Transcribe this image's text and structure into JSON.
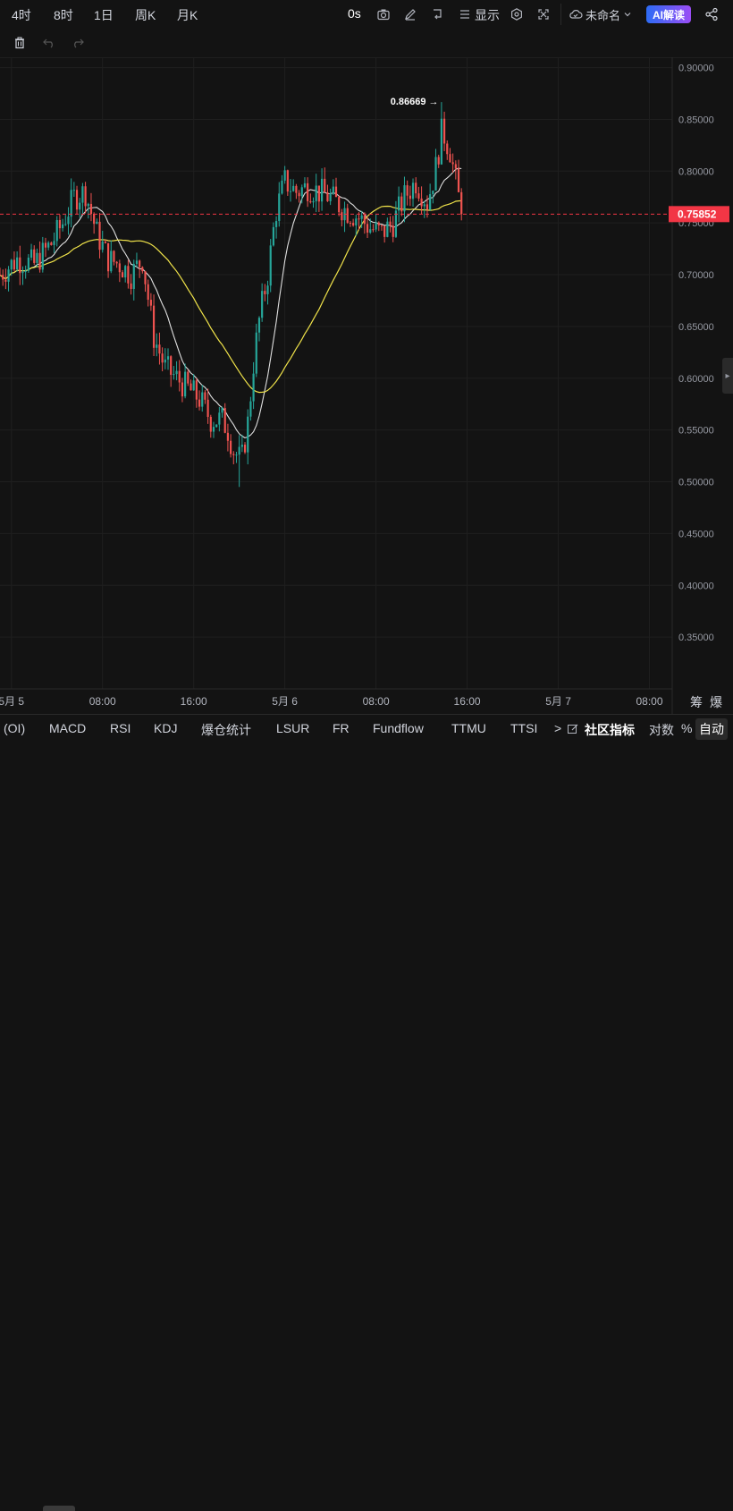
{
  "toolbar": {
    "timeframes": [
      "4时",
      "8时",
      "1日",
      "周K",
      "月K"
    ],
    "countdown": "0s",
    "display_label": "显示",
    "layout_name": "未命名",
    "ai_label": "AI解读"
  },
  "bottom_bar": {
    "indicators": [
      "(OI)",
      "MACD",
      "RSI",
      "KDJ",
      "爆仓统计",
      "LSUR",
      "FR",
      "Fundflow",
      "TTMU",
      "TTSI"
    ],
    "more_label": ">",
    "community_label": "社区指标",
    "log_label": "对数",
    "percent_label": "%",
    "auto_label": "自动"
  },
  "colors": {
    "up": "#26a69a",
    "down": "#ef5350",
    "ma_fast": "#e0e0e0",
    "ma_slow": "#f0e34a",
    "price_tag": "#f23645",
    "background": "#131313",
    "grid": "#1f1f1f"
  },
  "chart_data": {
    "type": "candlestick",
    "symbol_price": "0.75852",
    "high_marker": "0.86669 →",
    "y_ticks": [
      "0.90000",
      "0.85000",
      "0.80000",
      "0.75000",
      "0.70000",
      "0.65000",
      "0.60000",
      "0.55000",
      "0.50000",
      "0.45000",
      "0.40000",
      "0.35000"
    ],
    "x_ticks": [
      "5月 5",
      "08:00",
      "16:00",
      "5月 6",
      "08:00",
      "16:00",
      "5月 7",
      "08:00"
    ],
    "x_tick_hours": [
      0,
      8,
      16,
      24,
      32,
      40,
      48,
      56
    ],
    "axis_extra": [
      "筹",
      "爆"
    ],
    "ylim": [
      0.3,
      0.91
    ],
    "xlim": [
      -1,
      58
    ],
    "last_price": 0.75852,
    "high": {
      "hour": 37.8,
      "value": 0.86669
    },
    "low": {
      "hour": 19.9,
      "value": 0.495
    },
    "path_points": [
      [
        -1,
        0.7
      ],
      [
        0.5,
        0.715
      ],
      [
        2,
        0.71
      ],
      [
        3.5,
        0.73
      ],
      [
        4.5,
        0.75
      ],
      [
        5.5,
        0.775
      ],
      [
        6.5,
        0.78
      ],
      [
        7.5,
        0.74
      ],
      [
        8.5,
        0.715
      ],
      [
        9.5,
        0.71
      ],
      [
        10.5,
        0.7
      ],
      [
        11.5,
        0.715
      ],
      [
        12.5,
        0.64
      ],
      [
        13.5,
        0.61
      ],
      [
        14.5,
        0.6
      ],
      [
        15.5,
        0.59
      ],
      [
        16.5,
        0.58
      ],
      [
        17.5,
        0.56
      ],
      [
        18.5,
        0.56
      ],
      [
        19,
        0.55
      ],
      [
        19.5,
        0.53
      ],
      [
        20.2,
        0.52
      ],
      [
        20.8,
        0.56
      ],
      [
        21.3,
        0.62
      ],
      [
        21.8,
        0.66
      ],
      [
        22.5,
        0.7
      ],
      [
        23.2,
        0.76
      ],
      [
        24,
        0.79
      ],
      [
        25,
        0.78
      ],
      [
        26,
        0.785
      ],
      [
        27,
        0.78
      ],
      [
        28,
        0.775
      ],
      [
        29,
        0.765
      ],
      [
        30.5,
        0.755
      ],
      [
        31.5,
        0.745
      ],
      [
        32.5,
        0.74
      ],
      [
        33.5,
        0.75
      ],
      [
        34.5,
        0.775
      ],
      [
        35.5,
        0.79
      ],
      [
        36.5,
        0.77
      ],
      [
        37.2,
        0.8
      ],
      [
        37.8,
        0.84
      ],
      [
        38.5,
        0.82
      ],
      [
        39,
        0.79
      ],
      [
        39.5,
        0.76
      ]
    ]
  }
}
